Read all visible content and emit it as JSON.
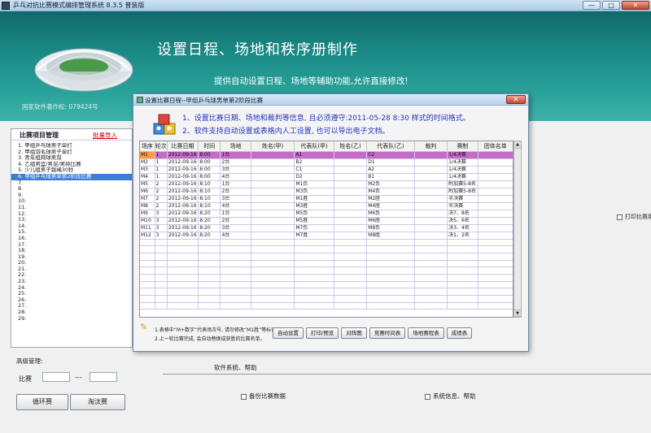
{
  "window": {
    "title": "乒乓对抗比赛模式编排管理系统 8.3.5 普装版",
    "btn_min": "—",
    "btn_max": "□",
    "btn_close": "✕"
  },
  "banner": {
    "headline": "设置日程、场地和秩序册制作",
    "subline": "提供自动设置日程、场地等辅助功能,允许直接修改!",
    "copyright": "国家软件著作权: 079424号"
  },
  "left_panel": {
    "title": "比赛项目管理",
    "import_link": "批量导入",
    "items": [
      "1. 甲组乒乓球男子单打",
      "2. 甲组羽毛球男子单打",
      "3. 青年组网球男双",
      "4. 乙组男篮/男足/男排比赛",
      "5. 少儿组男子跳绳30秒",
      "6. 甲组乒乓球男单第2阶段比赛",
      "7.",
      "8.",
      "9.",
      "10.",
      "11.",
      "12.",
      "13.",
      "14.",
      "15.",
      "16.",
      "17.",
      "18.",
      "19.",
      "20.",
      "21.",
      "22.",
      "23.",
      "24.",
      "25.",
      "26.",
      "27.",
      "28.",
      "29."
    ],
    "selected_index": 5
  },
  "dialog": {
    "title": "设置比赛日程--甲组乒乓球男单第2阶段比赛",
    "close": "✕",
    "info_line1": "1、设置比赛日期、场地和裁判等信息, 且必须遵守:2011-05-28  8:30 样式的时间格式。",
    "info_line2": "2、软件支持自动设置或表格内人工设置, 也可以导出电子文档。",
    "columns": [
      "场序",
      "轮次",
      "比赛日期",
      "时间",
      "场地",
      "姓名(甲)",
      "代表队(甲)",
      "姓名(乙)",
      "代表队(乙)",
      "裁判",
      "赛制",
      "团体名单"
    ],
    "rows": [
      [
        "M1",
        "1",
        "2012-09-16",
        "8:00",
        "1台",
        "",
        "A1",
        "",
        "C2",
        "",
        "1/4决赛",
        ""
      ],
      [
        "M2",
        "1",
        "2012-09-16",
        "8:00",
        "2台",
        "",
        "B2",
        "",
        "D1",
        "",
        "1/4决赛",
        ""
      ],
      [
        "M3",
        "1",
        "2012-09-16",
        "8:00",
        "3台",
        "",
        "C1",
        "",
        "A2",
        "",
        "1/4决赛",
        ""
      ],
      [
        "M4",
        "1",
        "2012-09-16",
        "8:00",
        "4台",
        "",
        "D2",
        "",
        "B1",
        "",
        "1/4决赛",
        ""
      ],
      [
        "M5",
        "2",
        "2012-09-16",
        "8:10",
        "1台",
        "",
        "M1负",
        "",
        "M2负",
        "",
        "附加赛5-8名",
        ""
      ],
      [
        "M6",
        "2",
        "2012-09-16",
        "8:10",
        "2台",
        "",
        "M3负",
        "",
        "M4负",
        "",
        "附加赛5-8名",
        ""
      ],
      [
        "M7",
        "2",
        "2012-09-16",
        "8:10",
        "3台",
        "",
        "M1胜",
        "",
        "M2胜",
        "",
        "半决赛",
        ""
      ],
      [
        "M8",
        "2",
        "2012-09-16",
        "8:10",
        "4台",
        "",
        "M3胜",
        "",
        "M4胜",
        "",
        "半决赛",
        ""
      ],
      [
        "M9",
        "3",
        "2012-09-16",
        "8:20",
        "1台",
        "",
        "M5负",
        "",
        "M6负",
        "",
        "决7、8名",
        ""
      ],
      [
        "M10",
        "3",
        "2012-09-16",
        "8:20",
        "2台",
        "",
        "M5胜",
        "",
        "M6胜",
        "",
        "决5、6名",
        ""
      ],
      [
        "M11",
        "3",
        "2012-09-16",
        "8:20",
        "3台",
        "",
        "M7负",
        "",
        "M8负",
        "",
        "决3、4名",
        ""
      ],
      [
        "M12",
        "3",
        "2012-09-16",
        "8:20",
        "4台",
        "",
        "M7胜",
        "",
        "M8胜",
        "",
        "决1、2名",
        ""
      ]
    ],
    "highlight_row": 0,
    "note1": "1.表格中“M+数字”代表场次号, 请勿修改“M1胜”等标记。",
    "note2": "2.上一轮比赛完成, 会自动替换成获胜的比赛名单。",
    "buttons": [
      "自动设置",
      "打印/预览",
      "对阵图",
      "竞赛时间表",
      "场地赛程表",
      "成绩表"
    ]
  },
  "right": {
    "print_check": "打印比赛用表"
  },
  "bottom": {
    "advanced": "高级管理:",
    "match_label": "比赛",
    "dash": "---",
    "round_robin": "循环赛",
    "knockout": "淘汰赛",
    "system_help": "软件系统、帮助",
    "backup": "备份比赛数据",
    "sysinfo": "系统信息、帮助"
  }
}
